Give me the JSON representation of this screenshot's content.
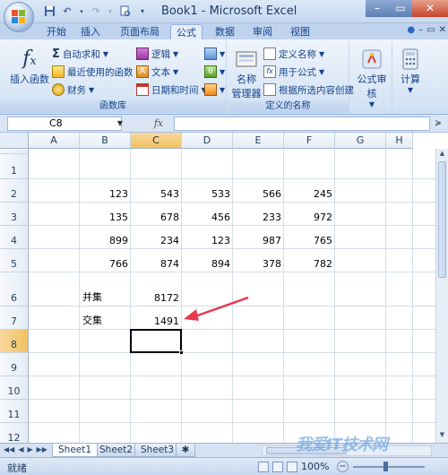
{
  "window": {
    "title": "Book1 - Microsoft Excel",
    "min_glyph": "–",
    "max_glyph": "▭",
    "close_glyph": "✕"
  },
  "qat": {
    "items": [
      "save-icon",
      "undo-icon",
      "redo-icon",
      "print-preview-icon",
      "customize-icon"
    ]
  },
  "tabs": [
    {
      "label": "开始",
      "active": false
    },
    {
      "label": "插入",
      "active": false
    },
    {
      "label": "页面布局",
      "active": false
    },
    {
      "label": "公式",
      "active": true
    },
    {
      "label": "数据",
      "active": false
    },
    {
      "label": "审阅",
      "active": false
    },
    {
      "label": "视图",
      "active": false
    }
  ],
  "ribbon": {
    "insert_function": "插入函数",
    "autosum": "自动求和",
    "recent": "最近使用的函数",
    "financial": "财务",
    "logical": "逻辑",
    "text": "文本",
    "datetime": "日期和时间",
    "library_label": "函数库",
    "name_manager_line1": "名称",
    "name_manager_line2": "管理器",
    "define_name": "定义名称",
    "use_in_formula": "用于公式",
    "create_from_selection": "根据所选内容创建",
    "names_label": "定义的名称",
    "formula_auditing": "公式审核",
    "calculation": "计算"
  },
  "formula_bar": {
    "name_box": "C8",
    "fx": "fx",
    "value": ""
  },
  "columns": [
    "A",
    "B",
    "C",
    "D",
    "E",
    "F",
    "G",
    "H"
  ],
  "rows": [
    "1",
    "2",
    "3",
    "4",
    "5",
    "6",
    "7",
    "8",
    "9",
    "10",
    "11",
    "12"
  ],
  "cells": {
    "B2": "123",
    "C2": "543",
    "D2": "533",
    "E2": "566",
    "F2": "245",
    "B3": "135",
    "C3": "678",
    "D3": "456",
    "E3": "233",
    "F3": "972",
    "B4": "899",
    "C4": "234",
    "D4": "123",
    "E4": "987",
    "F4": "765",
    "B5": "766",
    "C5": "874",
    "D5": "894",
    "E5": "378",
    "F5": "782",
    "B6": "并集",
    "C6": "8172",
    "B7": "交集",
    "C7": "1491"
  },
  "selected_cell": "C8",
  "sheets": [
    {
      "label": "Sheet1",
      "active": true
    },
    {
      "label": "Sheet2",
      "active": false
    },
    {
      "label": "Sheet3",
      "active": false
    }
  ],
  "status": {
    "ready": "就绪",
    "zoom": "100%"
  },
  "watermark": "我爱IT技术网",
  "colors": {
    "annotation_arrow": "#e8384f",
    "selected_header": "#f1c15f",
    "ribbon_text": "#15428b"
  }
}
